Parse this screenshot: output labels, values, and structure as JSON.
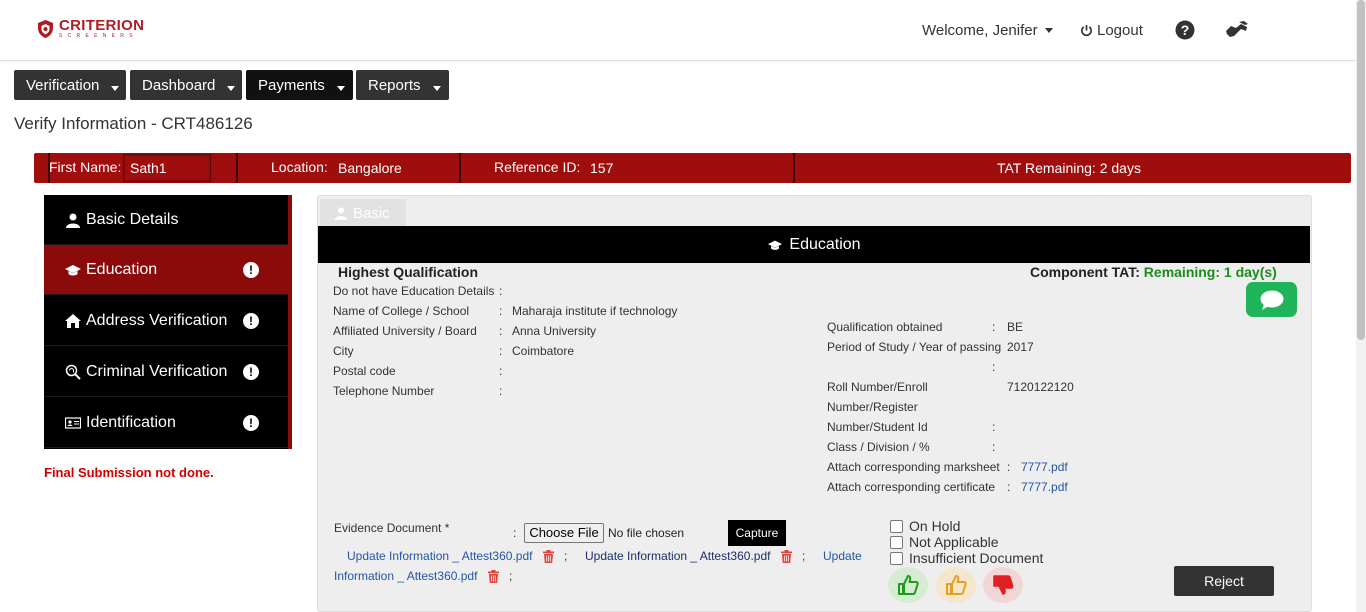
{
  "brand": {
    "name": "CRITERION",
    "sub": "SCREENERS",
    "color": "#b01b24"
  },
  "header": {
    "welcome": "Welcome, Jenifer",
    "logout": "Logout",
    "help_icon": "question-circle-icon",
    "extra_icon": "handshake-icon"
  },
  "nav": {
    "items": [
      {
        "label": "Verification"
      },
      {
        "label": "Dashboard"
      },
      {
        "label": "Payments"
      },
      {
        "label": "Reports"
      }
    ]
  },
  "page": {
    "title": "Verify Information - CRT486126"
  },
  "infobar": {
    "first_name_label": "First Name:",
    "first_name_value": "Sath1",
    "location_label": "Location:",
    "location_value": "Bangalore",
    "reference_label": "Reference ID:",
    "reference_value": "157",
    "tat": "TAT Remaining: 2 days",
    "color": "#a00d0d"
  },
  "sidebar": {
    "items": [
      {
        "label": "Basic Details",
        "icon": "user-icon",
        "active": false,
        "warning": false
      },
      {
        "label": "Education",
        "icon": "graduation-cap-icon",
        "active": true,
        "warning": true
      },
      {
        "label": "Address Verification",
        "icon": "home-icon",
        "active": false,
        "warning": true
      },
      {
        "label": "Criminal Verification",
        "icon": "fingerprint-search-icon",
        "active": false,
        "warning": true
      },
      {
        "label": "Identification",
        "icon": "id-card-icon",
        "active": false,
        "warning": true
      }
    ],
    "status": "Final Submission not done."
  },
  "tabs": {
    "basic": "Basic"
  },
  "education": {
    "header": "Education",
    "section_title": "Highest Qualification",
    "component_tat_label": "Component TAT:",
    "component_tat_value": "Remaining: 1 day(s)",
    "left_fields": [
      {
        "label": "Do not have Education Details",
        "value": ""
      },
      {
        "label": "Name of College / School",
        "value": "Maharaja institute if technology"
      },
      {
        "label": "Affiliated University / Board",
        "value": "Anna University"
      },
      {
        "label": "City",
        "value": "Coimbatore"
      },
      {
        "label": "Postal code",
        "value": ""
      },
      {
        "label": "Telephone Number",
        "value": ""
      }
    ],
    "right_fields": {
      "qualification_label": "Qualification obtained",
      "qualification_value": "BE",
      "period_label": "Period of Study / Year of passing",
      "period_value": "2017",
      "roll_label_1": "Roll Number/Enroll",
      "roll_label_2": "Number/Register",
      "roll_label_3": "Number/Student Id",
      "roll_value": "7120122120",
      "class_label": "Class / Division / %",
      "marksheet_label": "Attach corresponding marksheet",
      "marksheet_value": "7777.pdf",
      "certificate_label": "Attach corresponding certificate",
      "certificate_value": "7777.pdf"
    },
    "evidence": {
      "label": "Evidence Document *",
      "choose_file": "Choose File",
      "no_file": "No file chosen",
      "capture": "Capture",
      "file1": "Update Information _ Attest360.pdf",
      "file2": "Update Information _ Attest360.pdf",
      "file3_part1": "Update",
      "file3_part2": "Information _ Attest360.pdf"
    },
    "checkboxes": [
      {
        "label": "On Hold",
        "checked": false
      },
      {
        "label": "Not Applicable",
        "checked": false
      },
      {
        "label": "Insufficient Document",
        "checked": false
      }
    ],
    "actions": {
      "reject": "Reject"
    }
  }
}
